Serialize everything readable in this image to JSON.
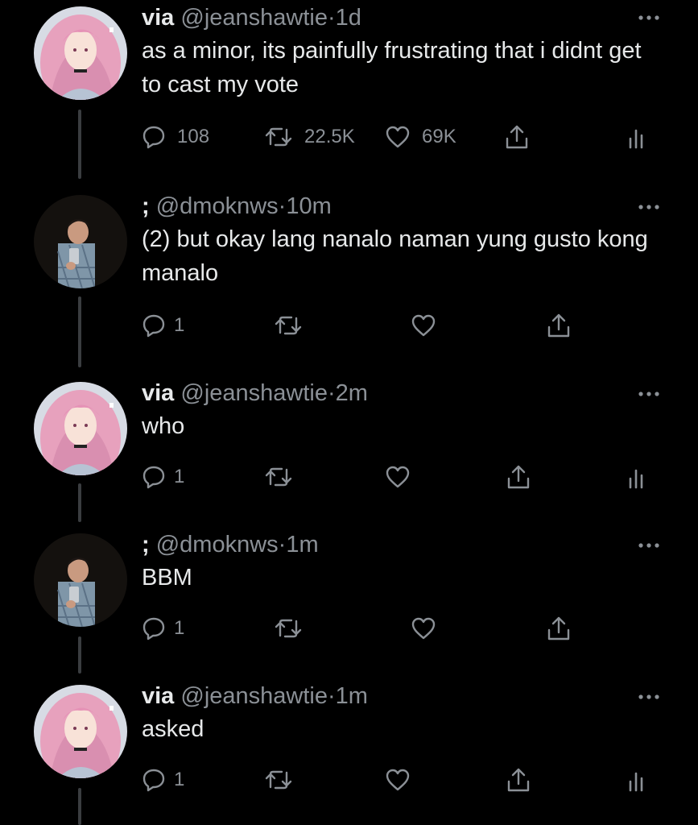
{
  "thread": [
    {
      "name": "via",
      "handle": "@jeanshawtie",
      "separator": "·",
      "time": "1d",
      "text": "as a minor, its painfully frustrating that i didnt get to cast my vote",
      "replies": "108",
      "retweets": "22.5K",
      "likes": "69K",
      "avatar": "pink-hair-anime-girl",
      "has_analytics": true
    },
    {
      "name": ";",
      "handle": "@dmoknws",
      "separator": "·",
      "time": "10m",
      "text": "(2) but okay lang nanalo naman yung gusto kong manalo",
      "replies": "1",
      "retweets": "",
      "likes": "",
      "avatar": "man-mirror-selfie",
      "has_analytics": false
    },
    {
      "name": "via",
      "handle": "@jeanshawtie",
      "separator": "·",
      "time": "2m",
      "text": "who",
      "replies": "1",
      "retweets": "",
      "likes": "",
      "avatar": "pink-hair-anime-girl",
      "has_analytics": true
    },
    {
      "name": ";",
      "handle": "@dmoknws",
      "separator": "·",
      "time": "1m",
      "text": "BBM",
      "replies": "1",
      "retweets": "",
      "likes": "",
      "avatar": "man-mirror-selfie",
      "has_analytics": false
    },
    {
      "name": "via",
      "handle": "@jeanshawtie",
      "separator": "·",
      "time": "1m",
      "text": "asked",
      "replies": "1",
      "retweets": "",
      "likes": "",
      "avatar": "pink-hair-anime-girl",
      "has_analytics": true
    }
  ],
  "icons": {
    "reply": "reply-icon",
    "retweet": "retweet-icon",
    "like": "heart-icon",
    "share": "share-icon",
    "analytics": "analytics-icon",
    "more": "more-options-icon"
  },
  "colors": {
    "background": "#000000",
    "text_primary": "#e7e9ea",
    "text_secondary": "#8b9096",
    "thread_line": "#3a3d40"
  }
}
